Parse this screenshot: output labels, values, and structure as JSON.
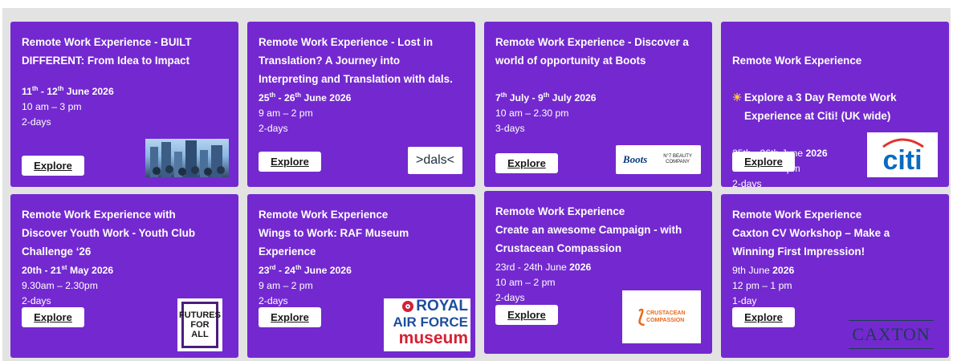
{
  "explore_label": "Explore",
  "colors": {
    "card": "#7329cf",
    "board": "#e3e3e3",
    "citi_blue": "#0a6bbf",
    "citi_red": "#e3332f",
    "raf_blue": "#1d4d9e",
    "raf_red": "#d62033"
  },
  "cards": [
    {
      "title": "Remote Work Experience -  BUILT\nDIFFERENT: From Idea to Impact",
      "date": "11th - 12th June 2026",
      "time": "10 am – 3 pm",
      "duration": "2-days",
      "logo": "city-skyline-photo"
    },
    {
      "title": "Remote Work Experience - Lost in\nTranslation? A Journey into\nInterpreting and Translation with dals.",
      "date": "25th - 26th June 2026",
      "time": "9 am – 2 pm",
      "duration": "2-days",
      "logo": "dals-logo",
      "logo_text": ">dals<"
    },
    {
      "title": "Remote Work Experience - Discover a\nworld of opportunity at Boots",
      "date": "7th July - 9th July 2026",
      "time": "10 am – 2.30 pm",
      "duration": "3-days",
      "logo": "boots-no7-logo",
      "logo_text": "Boots",
      "logo_text2": "N°7 BEAUTY COMPANY"
    },
    {
      "title_line1": "Remote Work Experience",
      "title_line2": "Explore a 3 Day Remote Work\nExperience at Citi! (UK wide)",
      "title_icon": "sun-icon",
      "date": "25th - 26th June 2026",
      "time": "9.30 am – 2 pm",
      "duration": "2-days",
      "logo": "citi-logo",
      "logo_text": "citi"
    },
    {
      "title": "Remote Work Experience with\nDiscover Youth Work - Youth Club\nChallenge ‘26",
      "date": "20th - 21st May 2026",
      "time": "9.30am – 2.30pm",
      "duration": "2-days",
      "logo": "futures-for-all-logo",
      "logo_text": "FUTURES",
      "logo_text2": "FOR ALL"
    },
    {
      "title": "Remote Work Experience\nWings to Work: RAF Museum\nExperience",
      "date": "23rd - 24th June 2026",
      "time": "9 am – 2 pm",
      "duration": "2-days",
      "logo": "raf-museum-logo",
      "logo_text": "ROYAL",
      "logo_text2": "AIR FORCE",
      "logo_text3": "museum"
    },
    {
      "title": "Remote Work Experience\nCreate an awesome Campaign - with\nCrustacean Compassion",
      "date": "23rd - 24th June 2026",
      "time": "10 am – 2 pm",
      "duration": "2-days",
      "logo": "crustacean-compassion-logo",
      "logo_text": "CRUSTACEAN",
      "logo_text2": "COMPASSION"
    },
    {
      "title": "Remote Work Experience\nCaxton CV Workshop – Make a\nWinning First Impression!",
      "date": "9th June 2026",
      "time": "12 pm – 1 pm",
      "duration": "1-day",
      "logo": "caxton-logo",
      "logo_text": "CAXTON"
    }
  ]
}
